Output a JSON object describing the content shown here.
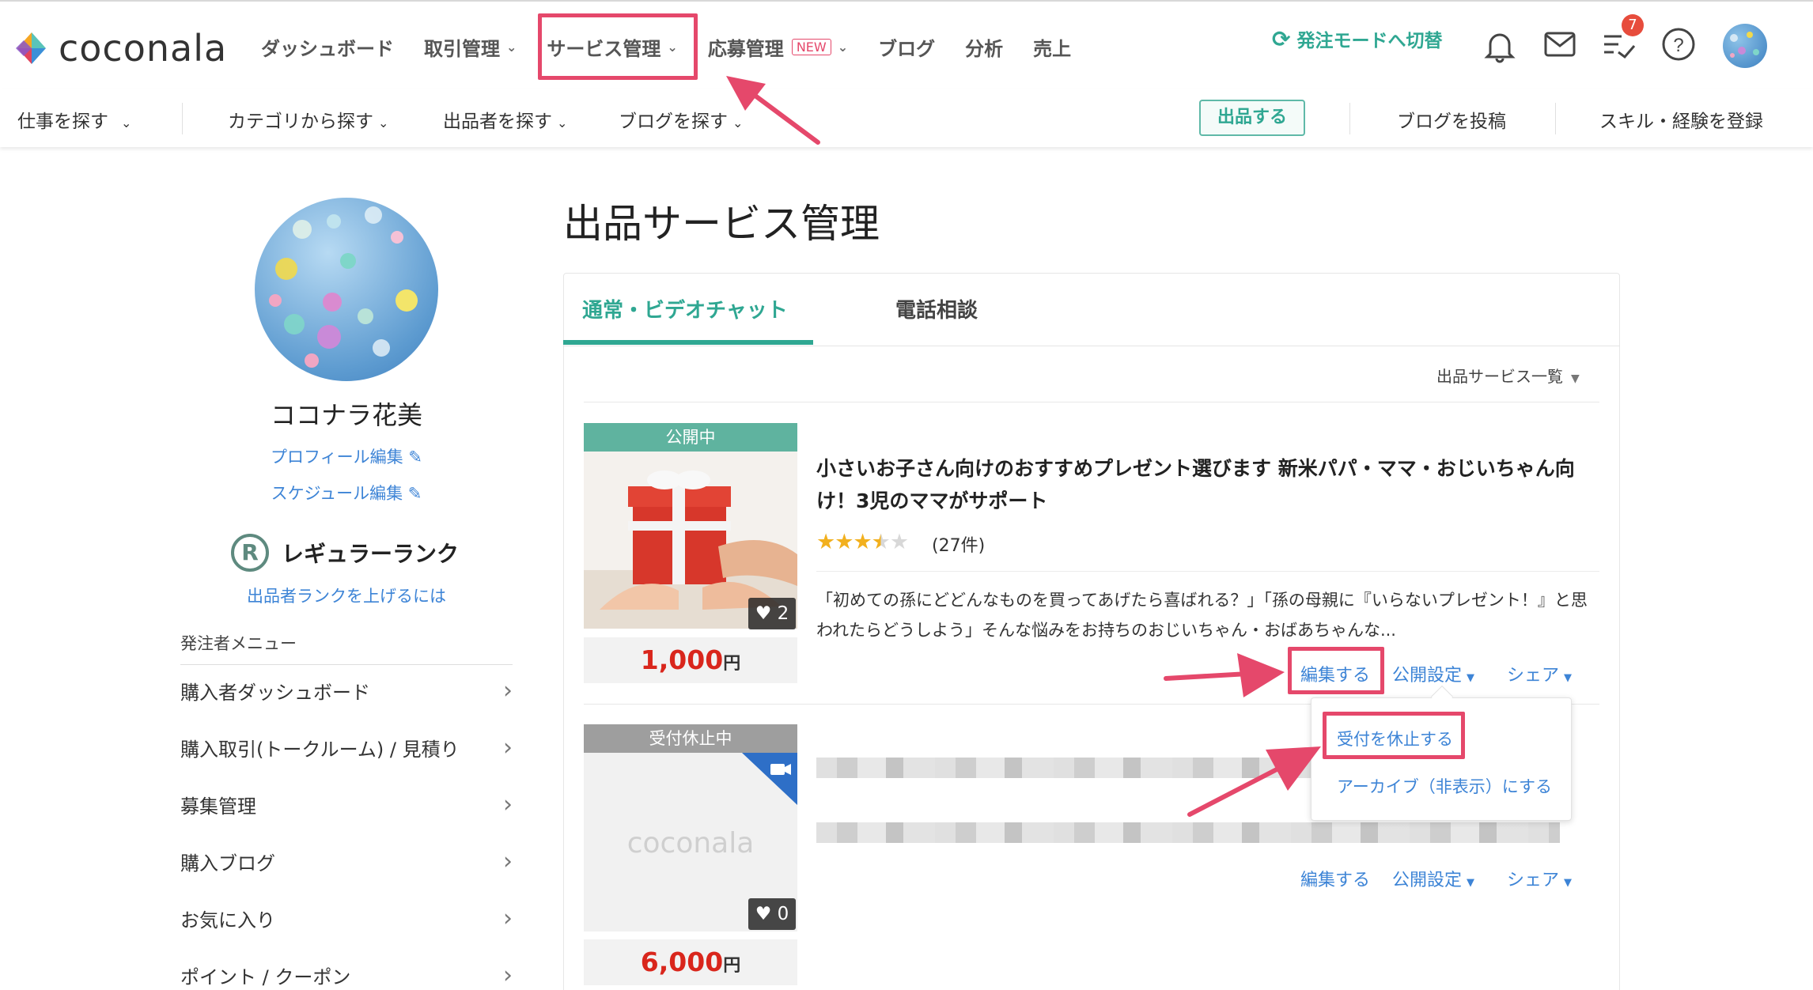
{
  "app": {
    "logo_text": "coconala"
  },
  "mainnav": {
    "dashboard": "ダッシュボード",
    "deals": "取引管理",
    "services": "サービス管理",
    "applications": "応募管理",
    "new_badge": "NEW",
    "blog": "ブログ",
    "analytics": "分析",
    "sales": "売上"
  },
  "tools": {
    "switch_mode": "発注モードへ切替",
    "todo_badge": "7"
  },
  "subnav": {
    "find_work": "仕事を探す",
    "by_category": "カテゴリから探す",
    "find_sellers": "出品者を探す",
    "find_blogs": "ブログを探す",
    "sell_button": "出品する",
    "post_blog": "ブログを投稿",
    "register_skills": "スキル・経験を登録"
  },
  "sidebar": {
    "username": "ココナラ花美",
    "edit_profile": "プロフィール編集",
    "edit_schedule": "スケジュール編集",
    "rank_letter": "R",
    "rank": "レギュラーランク",
    "rank_up_link": "出品者ランクを上げるには",
    "menu_header": "発注者メニュー",
    "menu": [
      {
        "label": "購入者ダッシュボード"
      },
      {
        "label": "購入取引(トークルーム) / 見積り"
      },
      {
        "label": "募集管理"
      },
      {
        "label": "購入ブログ"
      },
      {
        "label": "お気に入り"
      },
      {
        "label": "ポイント / クーポン"
      }
    ]
  },
  "main": {
    "page_title": "出品サービス管理",
    "tabs": [
      {
        "label": "通常・ビデオチャット",
        "active": true
      },
      {
        "label": "電話相談",
        "active": false
      }
    ],
    "list_select": "出品サービス一覧",
    "services": [
      {
        "status": "公開中",
        "status_color": "#5fb39f",
        "title": "小さいお子さん向けのおすすめプレゼント選びます 新米パパ・ママ・おじいちゃん向け！3児のママがサポート",
        "rating": 3.5,
        "reviews": "(27件)",
        "description": "「初めての孫にどどんなものを買ってあげたら喜ばれる？」「孫の母親に『いらないプレゼント！』と思われたらどうしよう」そんな悩みをお持ちのおじいちゃん・おばあちゃんな...",
        "likes": "2",
        "price": "1,000",
        "price_unit": "円"
      },
      {
        "status": "受付休止中",
        "status_color": "#9e9e9e",
        "thumb_text": "coconala",
        "likes": "0",
        "price": "6,000",
        "price_unit": "円"
      }
    ],
    "actions": {
      "edit": "編集する",
      "publish_settings": "公開設定",
      "share": "シェア"
    },
    "dropdown": {
      "pause": "受付を休止する",
      "archive": "アーカイブ（非表示）にする"
    }
  },
  "colors": {
    "accent": "#2fa792",
    "highlight": "#e5486b",
    "link": "#3d84d6",
    "price": "#d9261c"
  }
}
